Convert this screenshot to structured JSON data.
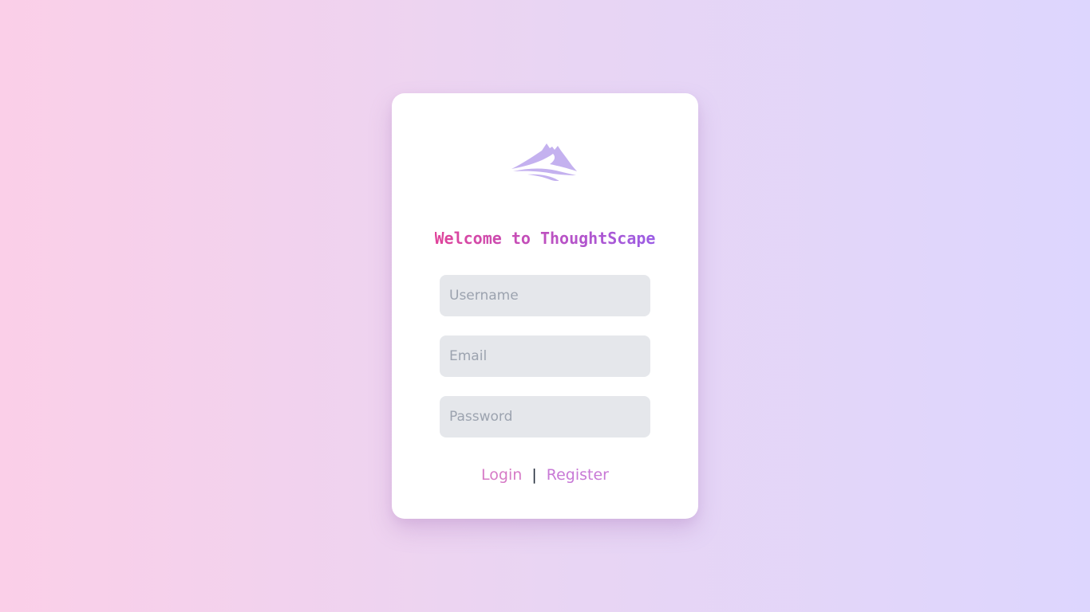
{
  "app": {
    "title": "Welcome to ThoughtScape",
    "logo_icon": "mountain-logo-icon"
  },
  "form": {
    "username_placeholder": "Username",
    "email_placeholder": "Email",
    "password_placeholder": "Password"
  },
  "links": {
    "login_label": "Login",
    "separator": "|",
    "register_label": "Register"
  },
  "colors": {
    "background_start": "#fbcfe8",
    "background_end": "#ddd6fe",
    "title_start": "#e0449a",
    "title_end": "#9b5de5",
    "logo": "#c4b1ef",
    "field_bg": "#e5e7eb",
    "link": "#d67ac6"
  }
}
